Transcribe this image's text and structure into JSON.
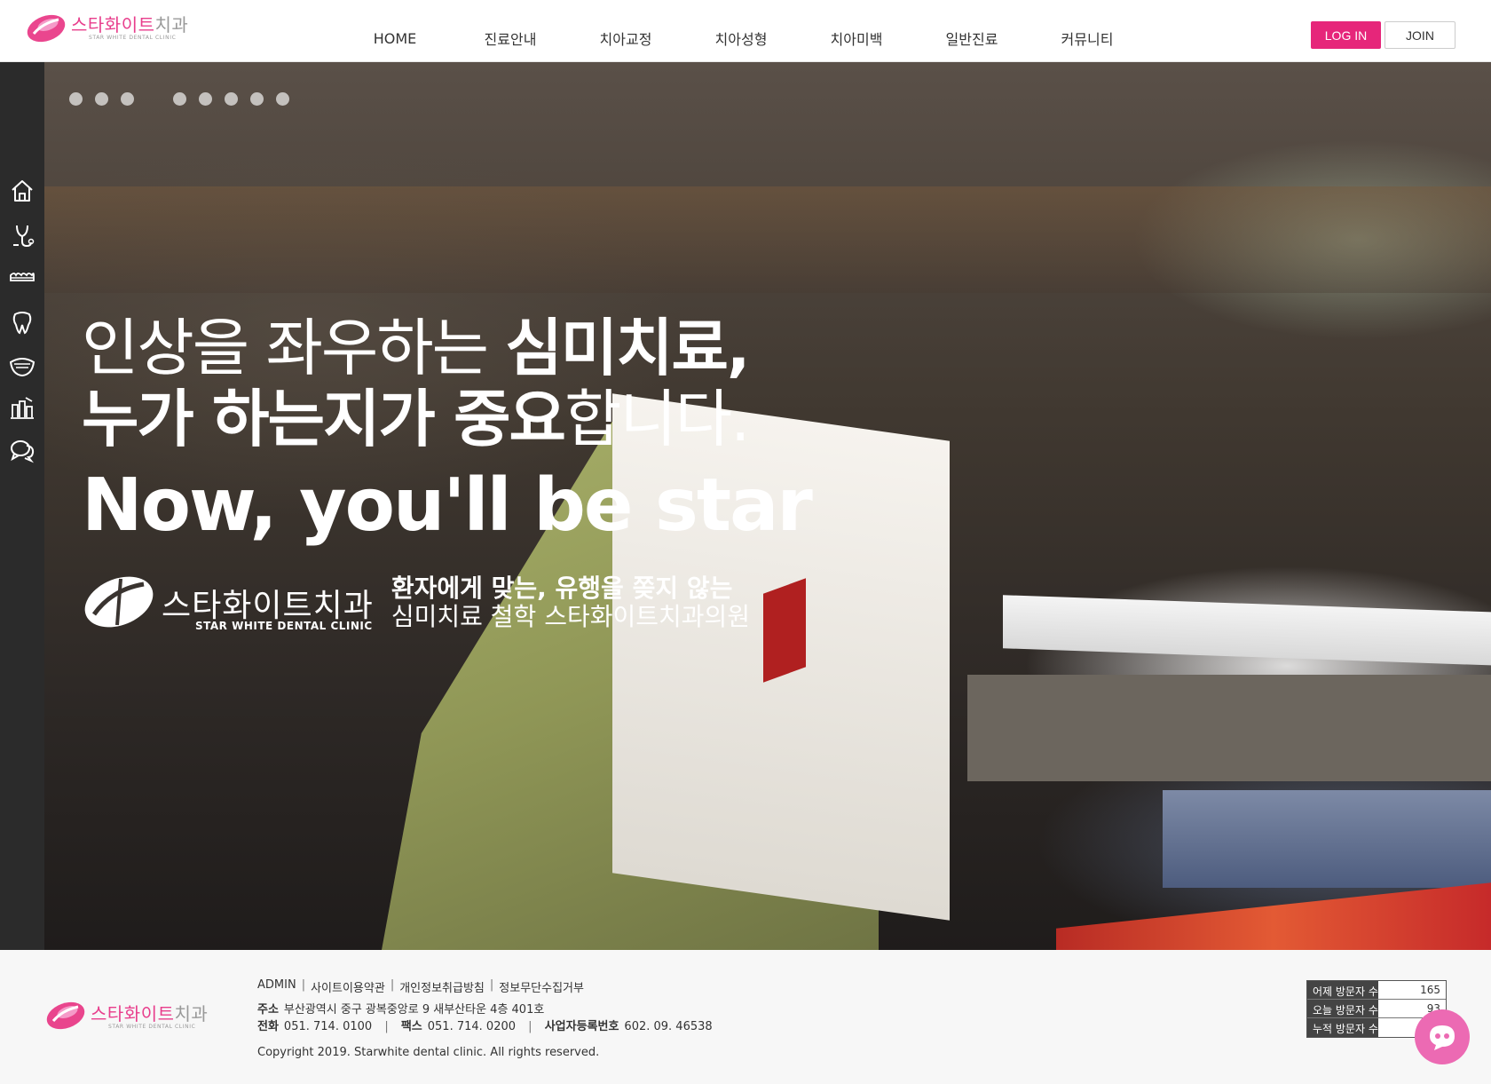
{
  "brand": {
    "logo_ko_pink": "스타화이트",
    "logo_ko_gray": "치과",
    "logo_en": "STAR WHITE DENTAL CLINIC",
    "accent": "#e6267a"
  },
  "nav": {
    "items": [
      "HOME",
      "진료안내",
      "치아교정",
      "치아성형",
      "치아미백",
      "일반진료",
      "커뮤니티"
    ]
  },
  "auth": {
    "login": "LOG IN",
    "join": "JOIN"
  },
  "sidebar": {
    "icons": [
      "home-icon",
      "dental-tools-icon",
      "braces-icon",
      "tooth-icon",
      "smile-icon",
      "dental-chair-icon",
      "chat-bubbles-icon"
    ]
  },
  "hero": {
    "line1_thin": "인상을 좌우하는 ",
    "line1_bold": "심미치료,",
    "line2_bold": "누가 하는지가 중요",
    "line2_thin": "합니다.",
    "line3": "Now, you'll be star",
    "brand_name": "스타화이트치과",
    "brand_en": "STAR WHITE DENTAL CLINIC",
    "tagline1": "환자에게 맞는, 유행을 쫒지 않는",
    "tagline2": "심미치료 철학 스타화이트치과의원",
    "slide_count": 8
  },
  "footer": {
    "links": [
      "ADMIN",
      "사이트이용약관",
      "개인정보취급방침",
      "정보무단수집거부"
    ],
    "address_label": "주소",
    "address": "부산광역시 중구 광복중앙로 9 새부산타운 4층 401호",
    "tel_label": "전화",
    "tel": "051. 714. 0100",
    "fax_label": "팩스",
    "fax": "051. 714. 0200",
    "biz_label": "사업자등록번호",
    "biz": "602. 09. 46538",
    "copyright": "Copyright 2019. Starwhite dental clinic. All rights reserved.",
    "logo_ko_pink": "스타화이트",
    "logo_ko_gray": "치과",
    "logo_en": "STAR WHITE DENTAL CLINIC"
  },
  "visitors": {
    "rows": [
      {
        "label": "어제 방문자 수",
        "value": "165"
      },
      {
        "label": "오늘 방문자 수",
        "value": "93"
      },
      {
        "label": "누적 방문자 수",
        "value": "1"
      }
    ]
  },
  "chat": {
    "icon": "chat-icon",
    "color": "#ec6ab3"
  }
}
